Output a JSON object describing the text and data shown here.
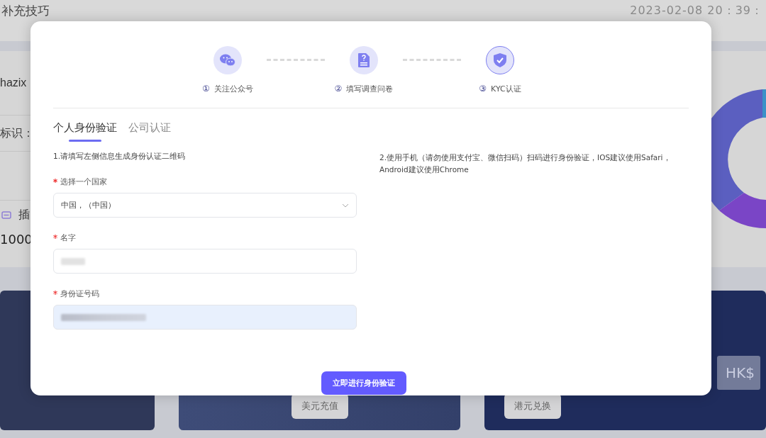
{
  "background": {
    "title": "补充技巧",
    "datetime": "2023-02-08 20：39：",
    "user": "hazix",
    "id_label": "标识：",
    "menu_item": "插",
    "amount": "1000",
    "card_buttons": [
      "美元充值",
      "港元兑换"
    ],
    "card_currency": "HK$"
  },
  "steps": [
    {
      "number": "①",
      "label": "关注公众号",
      "selected": false
    },
    {
      "number": "②",
      "label": "填写调查问卷",
      "selected": false
    },
    {
      "number": "③",
      "label": "KYC认证",
      "selected": true
    }
  ],
  "tabs": [
    {
      "label": "个人身份验证",
      "selected": true
    },
    {
      "label": "公司认证",
      "selected": false
    }
  ],
  "instruction_left": "1.请填写左侧信息生成身份认证二维码",
  "instruction_right": "2.使用手机（请勿使用支付宝、微信扫码）扫码进行身份验证，IOS建议使用Safari，Android建议使用Chrome",
  "fields": [
    {
      "kind": "select",
      "label": "选择一个国家",
      "required": true,
      "value": "中国，（中国）"
    },
    {
      "kind": "text",
      "label": "名字",
      "required": true,
      "highlighted": false
    },
    {
      "kind": "text",
      "label": "身份证号码",
      "required": true,
      "highlighted": true
    }
  ],
  "submit_button": "立即进行身份验证"
}
